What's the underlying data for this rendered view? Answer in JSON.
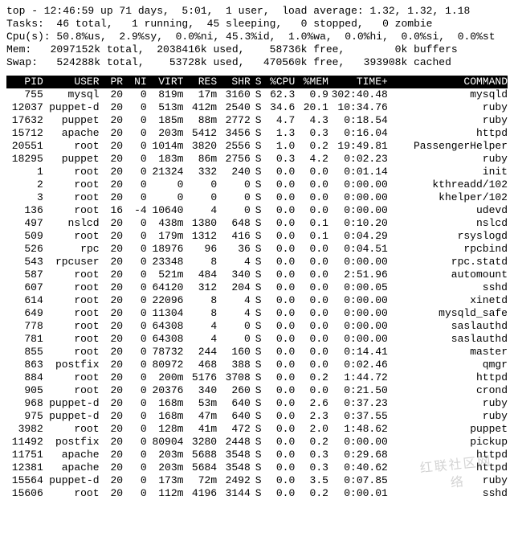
{
  "summary": {
    "line1": "top - 12:46:59 up 71 days,  5:01,  1 user,  load average: 1.32, 1.32, 1.18",
    "line2": "Tasks:  46 total,   1 running,  45 sleeping,   0 stopped,   0 zombie",
    "line3": "Cpu(s): 50.8%us,  2.9%sy,  0.0%ni, 45.3%id,  1.0%wa,  0.0%hi,  0.0%si,  0.0%st",
    "line4": "Mem:   2097152k total,  2038416k used,    58736k free,        0k buffers",
    "line5": "Swap:   524288k total,    53728k used,   470560k free,   393908k cached"
  },
  "columns": {
    "pid": "PID",
    "user": "USER",
    "pr": "PR",
    "ni": "NI",
    "virt": "VIRT",
    "res": "RES",
    "shr": "SHR",
    "s": "S",
    "cpu": "%CPU",
    "mem": "%MEM",
    "time": "TIME+",
    "cmd": "COMMAND"
  },
  "rows": [
    {
      "pid": "755",
      "user": "mysql",
      "pr": "20",
      "ni": "0",
      "virt": "819m",
      "res": "17m",
      "shr": "3160",
      "s": "S",
      "cpu": "62.3",
      "mem": "0.9",
      "time": "302:40.48",
      "cmd": "mysqld"
    },
    {
      "pid": "12037",
      "user": "puppet-d",
      "pr": "20",
      "ni": "0",
      "virt": "513m",
      "res": "412m",
      "shr": "2540",
      "s": "S",
      "cpu": "34.6",
      "mem": "20.1",
      "time": "10:34.76",
      "cmd": "ruby"
    },
    {
      "pid": "17632",
      "user": "puppet",
      "pr": "20",
      "ni": "0",
      "virt": "185m",
      "res": "88m",
      "shr": "2772",
      "s": "S",
      "cpu": "4.7",
      "mem": "4.3",
      "time": "0:18.54",
      "cmd": "ruby"
    },
    {
      "pid": "15712",
      "user": "apache",
      "pr": "20",
      "ni": "0",
      "virt": "203m",
      "res": "5412",
      "shr": "3456",
      "s": "S",
      "cpu": "1.3",
      "mem": "0.3",
      "time": "0:16.04",
      "cmd": "httpd"
    },
    {
      "pid": "20551",
      "user": "root",
      "pr": "20",
      "ni": "0",
      "virt": "1014m",
      "res": "3820",
      "shr": "2556",
      "s": "S",
      "cpu": "1.0",
      "mem": "0.2",
      "time": "19:49.81",
      "cmd": "PassengerHelper"
    },
    {
      "pid": "18295",
      "user": "puppet",
      "pr": "20",
      "ni": "0",
      "virt": "183m",
      "res": "86m",
      "shr": "2756",
      "s": "S",
      "cpu": "0.3",
      "mem": "4.2",
      "time": "0:02.23",
      "cmd": "ruby"
    },
    {
      "pid": "1",
      "user": "root",
      "pr": "20",
      "ni": "0",
      "virt": "21324",
      "res": "332",
      "shr": "240",
      "s": "S",
      "cpu": "0.0",
      "mem": "0.0",
      "time": "0:01.14",
      "cmd": "init"
    },
    {
      "pid": "2",
      "user": "root",
      "pr": "20",
      "ni": "0",
      "virt": "0",
      "res": "0",
      "shr": "0",
      "s": "S",
      "cpu": "0.0",
      "mem": "0.0",
      "time": "0:00.00",
      "cmd": "kthreadd/102"
    },
    {
      "pid": "3",
      "user": "root",
      "pr": "20",
      "ni": "0",
      "virt": "0",
      "res": "0",
      "shr": "0",
      "s": "S",
      "cpu": "0.0",
      "mem": "0.0",
      "time": "0:00.00",
      "cmd": "khelper/102"
    },
    {
      "pid": "136",
      "user": "root",
      "pr": "16",
      "ni": "-4",
      "virt": "10640",
      "res": "4",
      "shr": "0",
      "s": "S",
      "cpu": "0.0",
      "mem": "0.0",
      "time": "0:00.00",
      "cmd": "udevd"
    },
    {
      "pid": "497",
      "user": "nslcd",
      "pr": "20",
      "ni": "0",
      "virt": "438m",
      "res": "1380",
      "shr": "648",
      "s": "S",
      "cpu": "0.0",
      "mem": "0.1",
      "time": "0:10.20",
      "cmd": "nslcd"
    },
    {
      "pid": "509",
      "user": "root",
      "pr": "20",
      "ni": "0",
      "virt": "179m",
      "res": "1312",
      "shr": "416",
      "s": "S",
      "cpu": "0.0",
      "mem": "0.1",
      "time": "0:04.29",
      "cmd": "rsyslogd"
    },
    {
      "pid": "526",
      "user": "rpc",
      "pr": "20",
      "ni": "0",
      "virt": "18976",
      "res": "96",
      "shr": "36",
      "s": "S",
      "cpu": "0.0",
      "mem": "0.0",
      "time": "0:04.51",
      "cmd": "rpcbind"
    },
    {
      "pid": "543",
      "user": "rpcuser",
      "pr": "20",
      "ni": "0",
      "virt": "23348",
      "res": "8",
      "shr": "4",
      "s": "S",
      "cpu": "0.0",
      "mem": "0.0",
      "time": "0:00.00",
      "cmd": "rpc.statd"
    },
    {
      "pid": "587",
      "user": "root",
      "pr": "20",
      "ni": "0",
      "virt": "521m",
      "res": "484",
      "shr": "340",
      "s": "S",
      "cpu": "0.0",
      "mem": "0.0",
      "time": "2:51.96",
      "cmd": "automount"
    },
    {
      "pid": "607",
      "user": "root",
      "pr": "20",
      "ni": "0",
      "virt": "64120",
      "res": "312",
      "shr": "204",
      "s": "S",
      "cpu": "0.0",
      "mem": "0.0",
      "time": "0:00.05",
      "cmd": "sshd"
    },
    {
      "pid": "614",
      "user": "root",
      "pr": "20",
      "ni": "0",
      "virt": "22096",
      "res": "8",
      "shr": "4",
      "s": "S",
      "cpu": "0.0",
      "mem": "0.0",
      "time": "0:00.00",
      "cmd": "xinetd"
    },
    {
      "pid": "649",
      "user": "root",
      "pr": "20",
      "ni": "0",
      "virt": "11304",
      "res": "8",
      "shr": "4",
      "s": "S",
      "cpu": "0.0",
      "mem": "0.0",
      "time": "0:00.00",
      "cmd": "mysqld_safe"
    },
    {
      "pid": "778",
      "user": "root",
      "pr": "20",
      "ni": "0",
      "virt": "64308",
      "res": "4",
      "shr": "0",
      "s": "S",
      "cpu": "0.0",
      "mem": "0.0",
      "time": "0:00.00",
      "cmd": "saslauthd"
    },
    {
      "pid": "781",
      "user": "root",
      "pr": "20",
      "ni": "0",
      "virt": "64308",
      "res": "4",
      "shr": "0",
      "s": "S",
      "cpu": "0.0",
      "mem": "0.0",
      "time": "0:00.00",
      "cmd": "saslauthd"
    },
    {
      "pid": "855",
      "user": "root",
      "pr": "20",
      "ni": "0",
      "virt": "78732",
      "res": "244",
      "shr": "160",
      "s": "S",
      "cpu": "0.0",
      "mem": "0.0",
      "time": "0:14.41",
      "cmd": "master"
    },
    {
      "pid": "863",
      "user": "postfix",
      "pr": "20",
      "ni": "0",
      "virt": "80972",
      "res": "468",
      "shr": "388",
      "s": "S",
      "cpu": "0.0",
      "mem": "0.0",
      "time": "0:02.46",
      "cmd": "qmgr"
    },
    {
      "pid": "884",
      "user": "root",
      "pr": "20",
      "ni": "0",
      "virt": "200m",
      "res": "5176",
      "shr": "3708",
      "s": "S",
      "cpu": "0.0",
      "mem": "0.2",
      "time": "1:44.72",
      "cmd": "httpd"
    },
    {
      "pid": "905",
      "user": "root",
      "pr": "20",
      "ni": "0",
      "virt": "20376",
      "res": "340",
      "shr": "260",
      "s": "S",
      "cpu": "0.0",
      "mem": "0.0",
      "time": "0:21.50",
      "cmd": "crond"
    },
    {
      "pid": "968",
      "user": "puppet-d",
      "pr": "20",
      "ni": "0",
      "virt": "168m",
      "res": "53m",
      "shr": "640",
      "s": "S",
      "cpu": "0.0",
      "mem": "2.6",
      "time": "0:37.23",
      "cmd": "ruby"
    },
    {
      "pid": "975",
      "user": "puppet-d",
      "pr": "20",
      "ni": "0",
      "virt": "168m",
      "res": "47m",
      "shr": "640",
      "s": "S",
      "cpu": "0.0",
      "mem": "2.3",
      "time": "0:37.55",
      "cmd": "ruby"
    },
    {
      "pid": "3982",
      "user": "root",
      "pr": "20",
      "ni": "0",
      "virt": "128m",
      "res": "41m",
      "shr": "472",
      "s": "S",
      "cpu": "0.0",
      "mem": "2.0",
      "time": "1:48.62",
      "cmd": "puppet"
    },
    {
      "pid": "11492",
      "user": "postfix",
      "pr": "20",
      "ni": "0",
      "virt": "80904",
      "res": "3280",
      "shr": "2448",
      "s": "S",
      "cpu": "0.0",
      "mem": "0.2",
      "time": "0:00.00",
      "cmd": "pickup"
    },
    {
      "pid": "11751",
      "user": "apache",
      "pr": "20",
      "ni": "0",
      "virt": "203m",
      "res": "5688",
      "shr": "3548",
      "s": "S",
      "cpu": "0.0",
      "mem": "0.3",
      "time": "0:29.68",
      "cmd": "httpd"
    },
    {
      "pid": "12381",
      "user": "apache",
      "pr": "20",
      "ni": "0",
      "virt": "203m",
      "res": "5684",
      "shr": "3548",
      "s": "S",
      "cpu": "0.0",
      "mem": "0.3",
      "time": "0:40.62",
      "cmd": "httpd"
    },
    {
      "pid": "15564",
      "user": "puppet-d",
      "pr": "20",
      "ni": "0",
      "virt": "173m",
      "res": "72m",
      "shr": "2492",
      "s": "S",
      "cpu": "0.0",
      "mem": "3.5",
      "time": "0:07.85",
      "cmd": "ruby"
    },
    {
      "pid": "15606",
      "user": "root",
      "pr": "20",
      "ni": "0",
      "virt": "112m",
      "res": "4196",
      "shr": "3144",
      "s": "S",
      "cpu": "0.0",
      "mem": "0.2",
      "time": "0:00.01",
      "cmd": "sshd"
    }
  ],
  "watermark": "红联社区网络"
}
